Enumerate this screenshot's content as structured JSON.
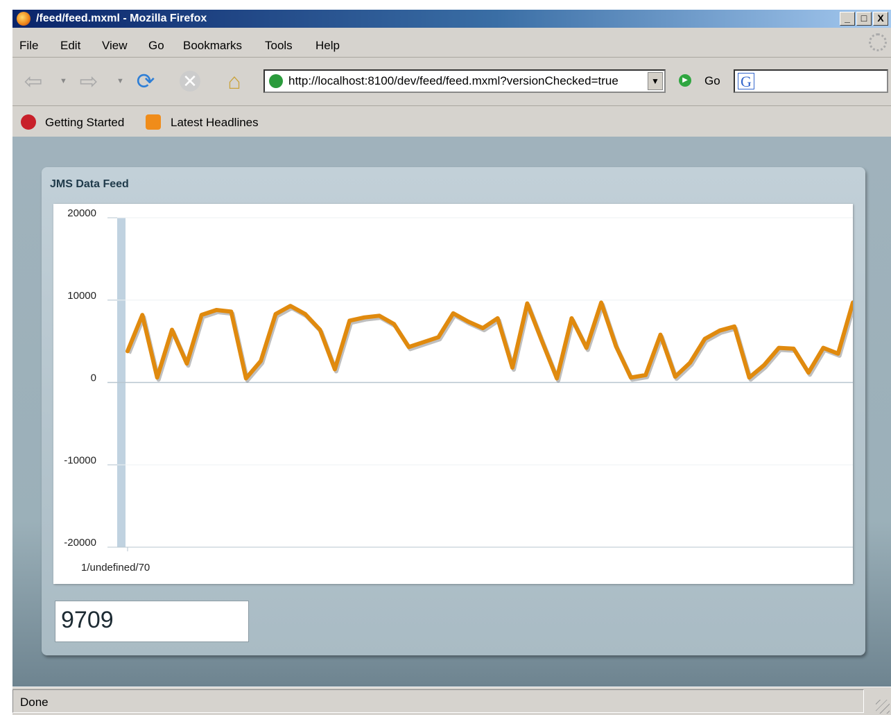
{
  "window": {
    "title": "/feed/feed.mxml - Mozilla Firefox",
    "controls": {
      "minimize": "_",
      "maximize": "□",
      "close": "X"
    }
  },
  "menubar": {
    "items": [
      "File",
      "Edit",
      "View",
      "Go",
      "Bookmarks",
      "Tools",
      "Help"
    ]
  },
  "navbar": {
    "url": "http://localhost:8100/dev/feed/feed.mxml?versionChecked=true",
    "go_label": "Go",
    "search_engine_icon": "G"
  },
  "bookmarks": {
    "items": [
      {
        "label": "Getting Started",
        "icon": "firefox-icon"
      },
      {
        "label": "Latest Headlines",
        "icon": "rss-feed-icon"
      }
    ]
  },
  "panel": {
    "title": "JMS Data Feed",
    "current_value": "9709"
  },
  "chart_data": {
    "type": "line",
    "title": "",
    "xlabel": "",
    "ylabel": "",
    "ylim": [
      -20000,
      20000
    ],
    "yticks": [
      "20000",
      "10000",
      "0",
      "-10000",
      "-20000"
    ],
    "xticks": [
      "1/undefined/70"
    ],
    "grid": true,
    "colors": {
      "line": "#e08a0e",
      "axis_band": "#c0d2e0"
    },
    "series": [
      {
        "values": [
          3800,
          8200,
          600,
          6400,
          2300,
          8200,
          8800,
          8600,
          500,
          2600,
          8300,
          9300,
          8300,
          6400,
          1600,
          7500,
          7900,
          8100,
          7100,
          4300,
          4900,
          5500,
          8400,
          7400,
          6600,
          7800,
          1800,
          9600,
          5000,
          500,
          7800,
          4200,
          9700,
          4400,
          600,
          900,
          5800,
          700,
          2400,
          5300,
          6300,
          6800,
          600,
          2100,
          4200,
          4100,
          1200,
          4200,
          3500,
          9709
        ]
      }
    ]
  },
  "status": {
    "text": "Done"
  }
}
